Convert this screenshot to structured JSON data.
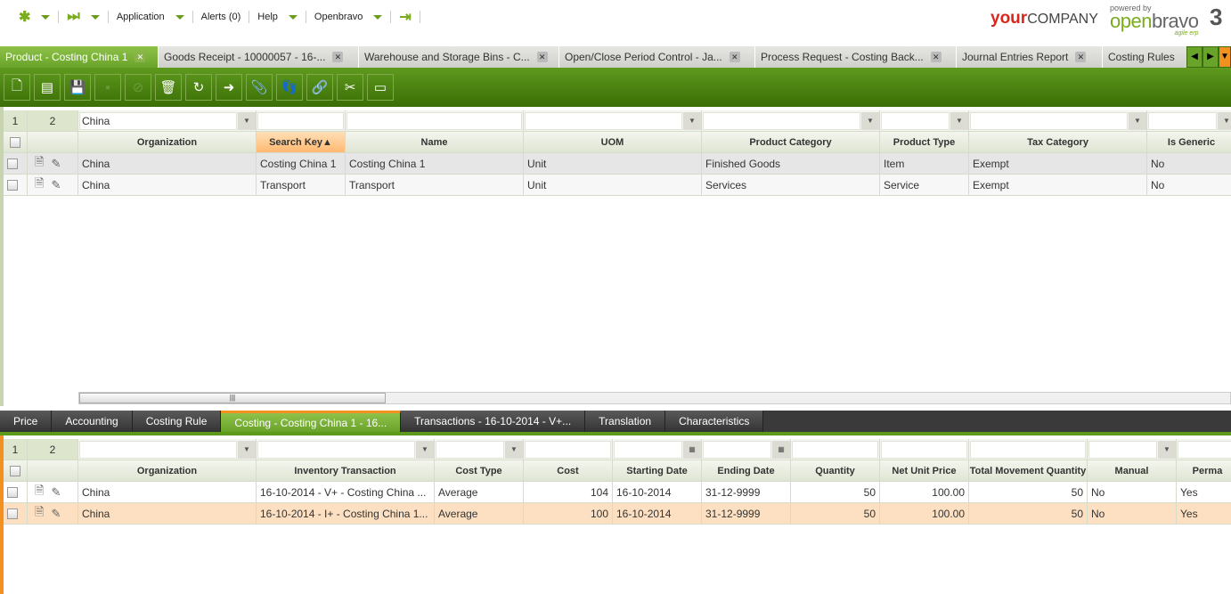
{
  "topnav": {
    "application": "Application",
    "alerts": "Alerts (0)",
    "help": "Help",
    "openbravo": "Openbravo"
  },
  "logo": {
    "your": "your",
    "company": "COMPANY",
    "powered_by": "powered by",
    "open": "open",
    "bravo": "bravo",
    "version": "3",
    "tagline": "agile erp"
  },
  "window_tabs": [
    {
      "label": "Product - Costing China 1",
      "active": true
    },
    {
      "label": "Goods Receipt - 10000057 - 16-..."
    },
    {
      "label": "Warehouse and Storage Bins - C..."
    },
    {
      "label": "Open/Close Period Control - Ja..."
    },
    {
      "label": "Process Request - Costing Back..."
    },
    {
      "label": "Journal Entries Report"
    },
    {
      "label": "Costing Rules"
    }
  ],
  "toolbar": [
    {
      "name": "new-document",
      "glyph": "🗋"
    },
    {
      "name": "new-row",
      "glyph": "▤"
    },
    {
      "name": "save",
      "glyph": "💾",
      "disabled": true
    },
    {
      "name": "save-close",
      "glyph": "▪",
      "disabled": true
    },
    {
      "name": "undo",
      "glyph": "⊘",
      "disabled": true
    },
    {
      "name": "delete",
      "glyph": "🗑"
    },
    {
      "name": "refresh",
      "glyph": "↻"
    },
    {
      "name": "export",
      "glyph": "➜"
    },
    {
      "name": "attach",
      "glyph": "📎"
    },
    {
      "name": "audit-trail",
      "glyph": "👣",
      "disabled": true
    },
    {
      "name": "link",
      "glyph": "🔗"
    },
    {
      "name": "personalize",
      "glyph": "✂"
    },
    {
      "name": "toggle-view",
      "glyph": "▭"
    }
  ],
  "upper_grid": {
    "counts": [
      "1",
      "2"
    ],
    "filters": [
      "China",
      "",
      "",
      "",
      "",
      "",
      "",
      ""
    ],
    "columns": [
      "Organization",
      "Search Key",
      "Name",
      "UOM",
      "Product Category",
      "Product Type",
      "Tax Category",
      "Is Generic"
    ],
    "sort_col": 1,
    "sort_glyph": "▲",
    "rows": [
      [
        "China",
        "Costing China 1",
        "Costing China 1",
        "Unit",
        "Finished Goods",
        "Item",
        "Exempt",
        "No"
      ],
      [
        "China",
        "Transport",
        "Transport",
        "Unit",
        "Services",
        "Service",
        "Exempt",
        "No"
      ]
    ]
  },
  "sub_tabs": [
    {
      "label": "Price"
    },
    {
      "label": "Accounting"
    },
    {
      "label": "Costing Rule"
    },
    {
      "label": "Costing - Costing China 1 - 16...",
      "active": true
    },
    {
      "label": "Transactions - 16-10-2014 - V+..."
    },
    {
      "label": "Translation"
    },
    {
      "label": "Characteristics"
    }
  ],
  "lower_grid": {
    "counts": [
      "1",
      "2"
    ],
    "columns": [
      "Organization",
      "Inventory Transaction",
      "Cost Type",
      "Cost",
      "Starting Date",
      "Ending Date",
      "Quantity",
      "Net Unit Price",
      "Total Movement Quantity",
      "Manual",
      "Perma"
    ],
    "rows": [
      [
        "China",
        "16-10-2014 - V+ - Costing China ...",
        "Average",
        "104",
        "16-10-2014",
        "31-12-9999",
        "50",
        "100.00",
        "50",
        "No",
        "Yes"
      ],
      [
        "China",
        "16-10-2014 - I+ - Costing China 1...",
        "Average",
        "100",
        "16-10-2014",
        "31-12-9999",
        "50",
        "100.00",
        "50",
        "No",
        "Yes"
      ]
    ]
  }
}
